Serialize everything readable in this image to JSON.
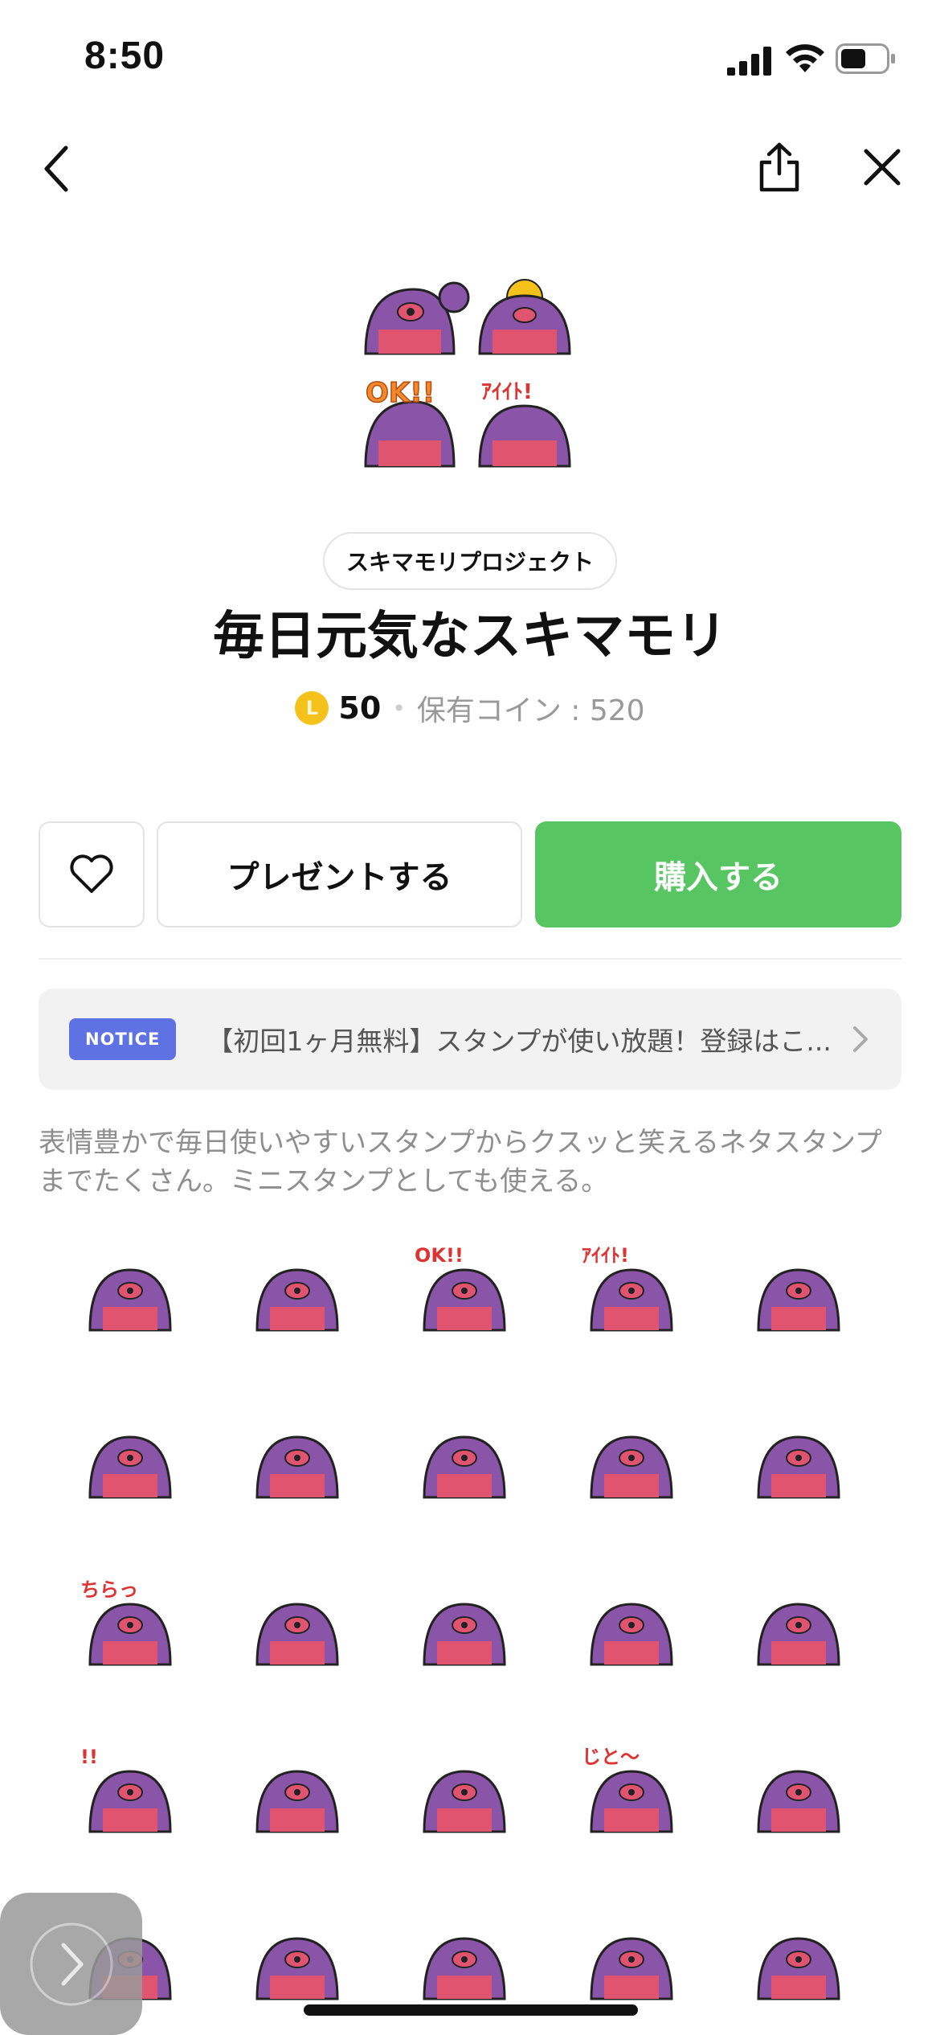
{
  "status_bar": {
    "time": "8:50"
  },
  "icons": {
    "back": "chevron-left-icon",
    "share": "share-icon",
    "close": "close-icon",
    "favorite": "heart-icon",
    "notice_arrow": "chevron-right-icon",
    "float": "chevron-right-icon"
  },
  "product": {
    "author": "スキマモリプロジェクト",
    "title": "毎日元気なスキマモリ",
    "coin_symbol": "L",
    "price": "50",
    "owned_coins": "保有コイン : 520"
  },
  "actions": {
    "gift_label": "プレゼントする",
    "buy_label": "購入する"
  },
  "notice": {
    "badge": "NOTICE",
    "text": "【初回1ヶ月無料】スタンプが使い放題！登録はこ..."
  },
  "description": "表情豊かで毎日使いやすいスタンプからクスッと笑えるネタスタンプまでたくさん。ミニスタンプとしても使える。",
  "stickers": {
    "rows": [
      [
        {
          "text": ""
        },
        {
          "text": ""
        },
        {
          "text": "OK!!"
        },
        {
          "text": "ｱｲｲﾄ!"
        },
        {
          "text": ""
        }
      ],
      [
        {
          "text": ""
        },
        {
          "text": ""
        },
        {
          "text": ""
        },
        {
          "text": ""
        },
        {
          "text": ""
        }
      ],
      [
        {
          "text": "ちらっ"
        },
        {
          "text": ""
        },
        {
          "text": ""
        },
        {
          "text": ""
        },
        {
          "text": ""
        }
      ],
      [
        {
          "text": "!!"
        },
        {
          "text": ""
        },
        {
          "text": ""
        },
        {
          "text": "じと〜"
        },
        {
          "text": ""
        }
      ],
      [
        {
          "text": ""
        },
        {
          "text": ""
        },
        {
          "text": ""
        },
        {
          "text": ""
        },
        {
          "text": ""
        }
      ]
    ]
  },
  "colors": {
    "accent_green": "#57c562",
    "notice_badge": "#5e72e4",
    "coin": "#f4c21b",
    "sticker_purple": "#8a55a8",
    "sticker_mouth": "#e0546f"
  }
}
